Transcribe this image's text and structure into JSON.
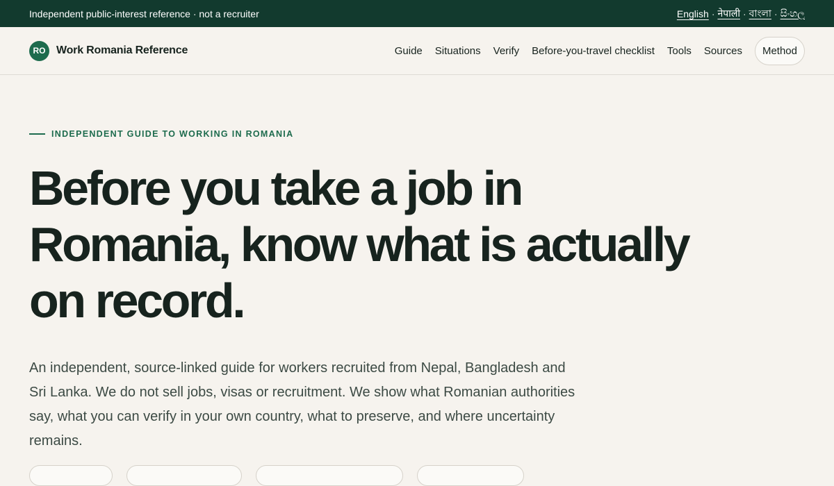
{
  "topbar": {
    "notice": "Independent public-interest reference · not a recruiter",
    "languages": [
      "English",
      "नेपाली",
      "বাংলা",
      "සිංහල"
    ],
    "separator": "·"
  },
  "header": {
    "logo_text": "RO",
    "site_name": "Work Romania Reference",
    "nav": [
      "Guide",
      "Situations",
      "Verify",
      "Before-you-travel checklist",
      "Tools",
      "Sources"
    ],
    "method_label": "Method"
  },
  "hero": {
    "eyebrow": "INDEPENDENT GUIDE TO WORKING IN ROMANIA",
    "headline": "Before you take a job in Romania, know what is actually on record.",
    "lede": "An independent, source-linked guide for workers recruited from Nepal, Bangladesh and Sri Lanka. We do not sell jobs, visas or recruitment. We show what Romanian authorities say, what you can verify in your own country, what to preserve, and where uncertainty remains."
  },
  "colors": {
    "topbar_bg": "#123a2e",
    "accent": "#1d6b4d",
    "page_bg": "#f6f3ee",
    "text": "#17231e"
  }
}
